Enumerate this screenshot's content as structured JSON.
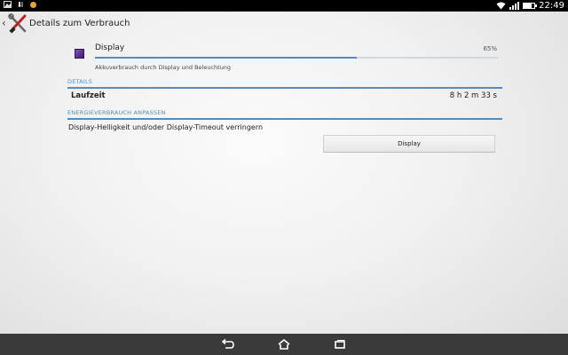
{
  "status_bar": {
    "left_icons": [
      "image-icon",
      "download-icon",
      "notification-icon"
    ],
    "time": "22:49",
    "battery_level": 0.7,
    "colors": {
      "background": "#000000",
      "notification": "#e8a23c"
    }
  },
  "action_bar": {
    "title": "Details zum Verbrauch",
    "icon": "tools-icon"
  },
  "app_usage": {
    "name": "Display",
    "percent_label": "65%",
    "percent": 0.65,
    "description": "Akkuverbrauch durch Display und Beleuchtung"
  },
  "details": {
    "header": "DETAILS",
    "runtime_label": "Laufzeit",
    "runtime_value": "8 h 2 m 33 s"
  },
  "adjust": {
    "header": "ENERGIEVERBRAUCH ANPASSEN",
    "advice": "Display-Helligkeit und/oder Display-Timeout verringern",
    "button_label": "Display"
  },
  "nav_bar": {
    "buttons": [
      "back-icon",
      "home-icon",
      "recent-apps-icon"
    ]
  },
  "accent_color": "#4a90c8"
}
